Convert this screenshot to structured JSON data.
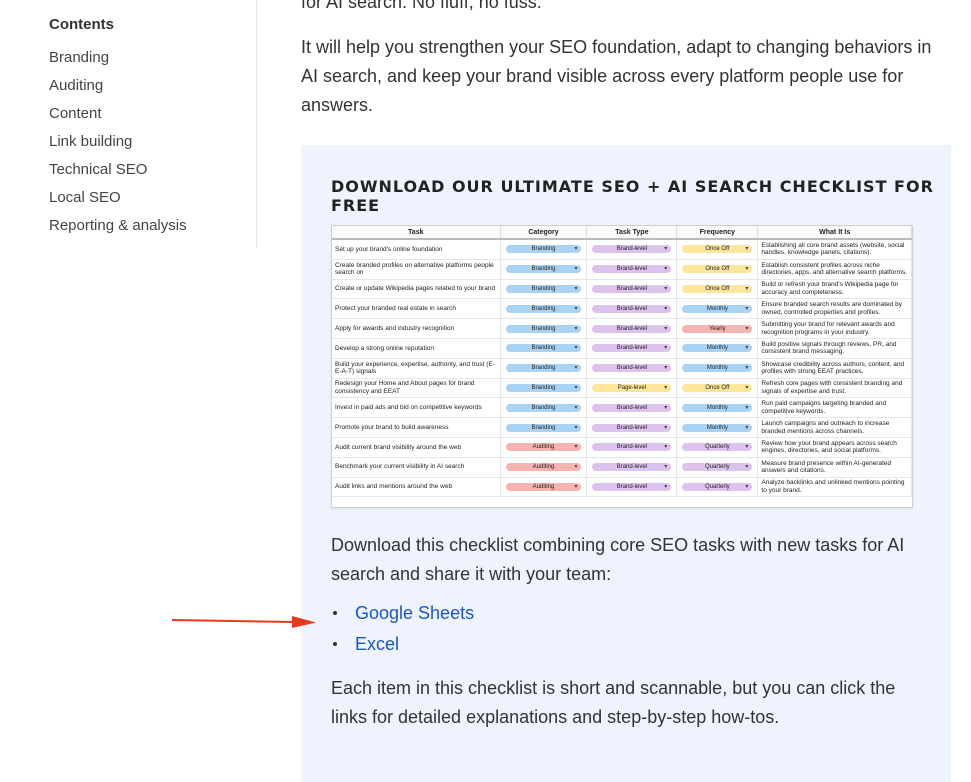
{
  "toc": {
    "title": "Contents",
    "items": [
      "Branding",
      "Auditing",
      "Content",
      "Link building",
      "Technical SEO",
      "Local SEO",
      "Reporting & analysis"
    ]
  },
  "main": {
    "top_cut_text": "for AI search. No fluff, no fuss.",
    "intro": "It will help you strengthen your SEO foundation, adapt to changing behaviors in AI search, and keep your brand visible across every platform people use for answers."
  },
  "callout": {
    "heading": "DOWNLOAD OUR ULTIMATE SEO + AI SEARCH CHECKLIST FOR FREE",
    "download_text": "Download this checklist combining core SEO tasks with new tasks for AI search and share it with your team:",
    "links": [
      "Google Sheets",
      "Excel"
    ],
    "closing_text": "Each item in this checklist is short and scannable, but you can click the links for detailed explanations and step-by-step how-tos."
  },
  "sheet": {
    "headers": [
      "Task",
      "Category",
      "Task Type",
      "Frequency",
      "What It Is"
    ],
    "rows": [
      [
        "Set up your brand's online foundation",
        "Branding",
        "Brand-level",
        "Once Off",
        "Establishing all core brand assets (website, social handles, knowledge panels, citations)."
      ],
      [
        "Create branded profiles on alternative platforms people search on",
        "Branding",
        "Brand-level",
        "Once Off",
        "Establish consistent profiles across niche directories, apps, and alternative search platforms."
      ],
      [
        "Create or update Wikipedia pages related to your brand",
        "Branding",
        "Brand-level",
        "Once Off",
        "Build or refresh your brand's Wikipedia page for accuracy and completeness."
      ],
      [
        "Protect your branded real estate in search",
        "Branding",
        "Brand-level",
        "Monthly",
        "Ensure branded search results are dominated by owned, controlled properties and profiles."
      ],
      [
        "Apply for awards and industry recognition",
        "Branding",
        "Brand-level",
        "Yearly",
        "Submitting your brand for relevant awards and recognition programs in your industry."
      ],
      [
        "Develop a strong online reputation",
        "Branding",
        "Brand-level",
        "Monthly",
        "Build positive signals through reviews, PR, and consistent brand messaging."
      ],
      [
        "Build your experience, expertise, authority, and trust (E-E-A-T) signals",
        "Branding",
        "Brand-level",
        "Monthly",
        "Showcase credibility across authors, content, and profiles with strong EEAT practices."
      ],
      [
        "Redesign your Home and About pages for brand consistency and EEAT",
        "Branding",
        "Page-level",
        "Once Off",
        "Refresh core pages with consistent branding and signals of expertise and trust."
      ],
      [
        "Invest in paid ads and bid on competitive keywords",
        "Branding",
        "Brand-level",
        "Monthly",
        "Run paid campaigns targeting branded and competitive keywords."
      ],
      [
        "Promote your brand to build awareness",
        "Branding",
        "Brand-level",
        "Monthly",
        "Launch campaigns and outreach to increase branded mentions across channels."
      ],
      [
        "Audit current brand visibility around the web",
        "Auditing",
        "Brand-level",
        "Quarterly",
        "Review how your brand appears across search engines, directories, and social platforms."
      ],
      [
        "Benchmark your current visibility in AI search",
        "Auditing",
        "Brand-level",
        "Quarterly",
        "Measure brand presence within AI-generated answers and citations."
      ],
      [
        "Audit links and mentions around the web",
        "Auditing",
        "Brand-level",
        "Quarterly",
        "Analyze backlinks and unlinked mentions pointing to your brand."
      ]
    ],
    "colors": {
      "Branding": "#a9d3f5",
      "Auditing": "#f7b3b0",
      "Brand-level": "#dcc2ec",
      "Page-level": "#fde59a",
      "Once Off": "#fde59a",
      "Monthly": "#a9d3f5",
      "Yearly": "#f7b3b0",
      "Quarterly": "#dcc2ec"
    }
  },
  "accent": {
    "link": "#1a56c4",
    "arrow": "#e8391f",
    "box_bg": "#eff3fd"
  }
}
